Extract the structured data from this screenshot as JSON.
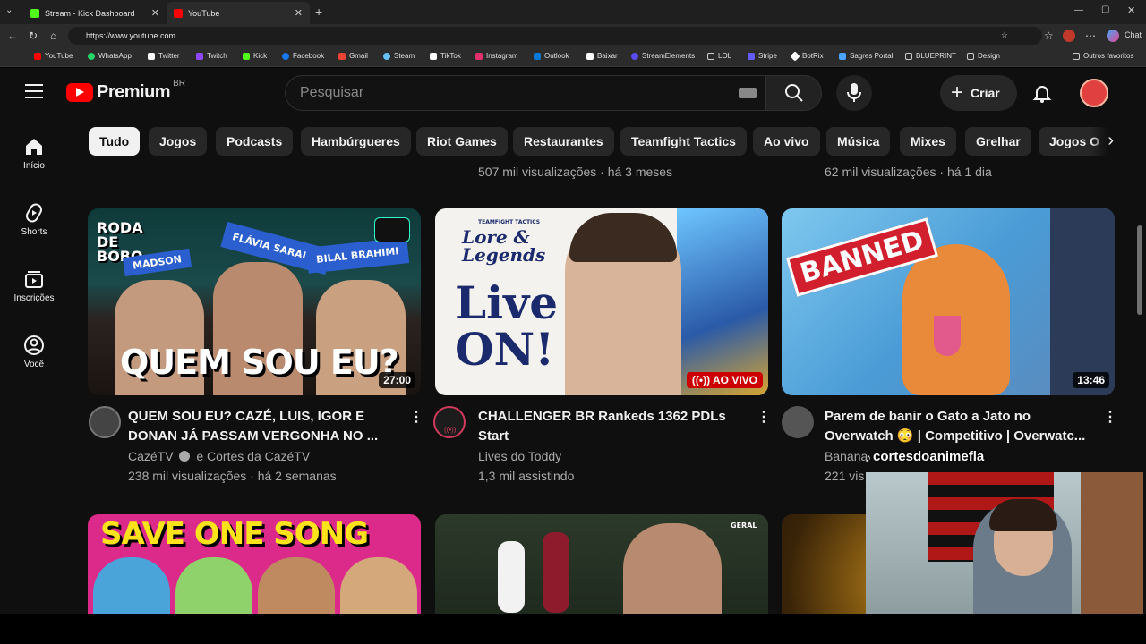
{
  "browser": {
    "tabs": [
      {
        "title": "Stream - Kick Dashboard",
        "favicon_color": "#53fc18"
      },
      {
        "title": "YouTube",
        "favicon_color": "#ff0000"
      }
    ],
    "url": "https://www.youtube.com",
    "bookmarks": [
      {
        "label": "YouTube",
        "color": "#ff0000"
      },
      {
        "label": "WhatsApp",
        "color": "#25d366"
      },
      {
        "label": "Twitter",
        "color": "#ffffff"
      },
      {
        "label": "Twitch",
        "color": "#9146ff"
      },
      {
        "label": "Kick",
        "color": "#53fc18"
      },
      {
        "label": "Facebook",
        "color": "#1877f2"
      },
      {
        "label": "Gmail",
        "color": "#ea4335"
      },
      {
        "label": "Steam",
        "color": "#66c0f4"
      },
      {
        "label": "TikTok",
        "color": "#ffffff"
      },
      {
        "label": "Instagram",
        "color": "#e1306c"
      },
      {
        "label": "Outlook",
        "color": "#0078d4"
      },
      {
        "label": "Baixar",
        "color": "#ffffff"
      },
      {
        "label": "StreamElements",
        "color": "#5b4bff"
      },
      {
        "label": "LOL",
        "color": "#cccccc"
      },
      {
        "label": "Stripe",
        "color": "#635bff"
      },
      {
        "label": "BotRix",
        "color": "#ffffff"
      },
      {
        "label": "Sagres Portal",
        "color": "#4aa3ff"
      },
      {
        "label": "BLUEPRINT",
        "color": "#cccccc"
      },
      {
        "label": "Design",
        "color": "#cccccc"
      }
    ],
    "other_favorites": "Outros favoritos",
    "chat_label": "Chat"
  },
  "youtube": {
    "logo_text": "Premium",
    "region": "BR",
    "search_placeholder": "Pesquisar",
    "create_label": "Criar",
    "sidebar": [
      {
        "label": "Início",
        "icon": "home-icon"
      },
      {
        "label": "Shorts",
        "icon": "shorts-icon"
      },
      {
        "label": "Inscrições",
        "icon": "subscriptions-icon"
      },
      {
        "label": "Você",
        "icon": "you-icon"
      }
    ],
    "chips": [
      "Tudo",
      "Jogos",
      "Podcasts",
      "Hambúrgueres",
      "Riot Games",
      "Restaurantes",
      "Teamfight Tactics",
      "Ao vivo",
      "Música",
      "Mixes",
      "Grelhar",
      "Jogos O"
    ],
    "prev_row_meta": [
      "507 mil visualizações · há 3 meses",
      "62 mil visualizações · há 1 dia"
    ],
    "videos": [
      {
        "title": "QUEM SOU EU? CAZÉ, LUIS, IGOR E DONAN JÁ PASSAM VERGONHA NO ...",
        "channel": "CazéTV",
        "channel_extra": "e Cortes da CazéTV",
        "meta": "238 mil visualizações · há 2 semanas",
        "duration": "27:00",
        "thumb_text": "QUEM SOU EU?",
        "thumb_tags": [
          "RODA DE BOBO",
          "MADSON",
          "FLÁVIA SARAIVA",
          "BILAL BRAHIMI"
        ]
      },
      {
        "title": "CHALLENGER BR Rankeds 1362 PDLs Start",
        "channel": "Lives do Toddy",
        "meta": "1,3 mil assistindo",
        "live_label": "AO VIVO",
        "thumb_text": "Live ON!",
        "thumb_sub": "Lore & Legends",
        "thumb_small": "TEAMFIGHT TACTICS"
      },
      {
        "title": "Parem de banir o Gato a Jato no Overwatch 😳 | Competitivo | Overwatc...",
        "channel": "Banana",
        "meta": "221 vis",
        "duration": "13:46",
        "thumb_text": "BANNED"
      }
    ],
    "row2_thumbs": [
      {
        "thumb_text": "SAVE ONE SONG"
      },
      {
        "thumb_text": "GERAL"
      }
    ]
  },
  "overlay": {
    "handle": "cortesdoanimefla"
  }
}
